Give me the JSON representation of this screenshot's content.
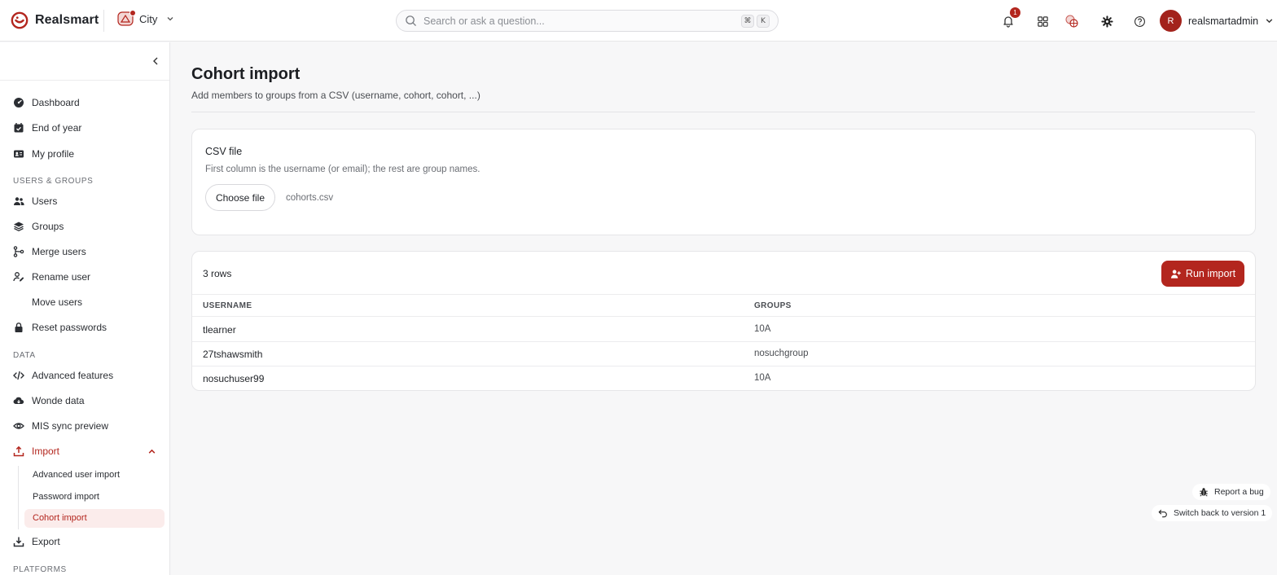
{
  "app": {
    "name": "Realsmart"
  },
  "school": {
    "name": "City"
  },
  "search": {
    "placeholder": "Search or ask a question...",
    "shortcut_keys": [
      "⌘",
      "K"
    ]
  },
  "header": {
    "notifications_count": "1",
    "user_initial": "R",
    "username": "realsmartadmin",
    "icons": [
      "bell-icon",
      "apps-grid-icon",
      "schools-globe-icon",
      "settings-gear-icon",
      "help-icon",
      "chevron-down-icon"
    ]
  },
  "sidebar": {
    "items": [
      {
        "label": "Dashboard",
        "icon": "dashboard-gauge-icon"
      },
      {
        "label": "End of year",
        "icon": "calendar-check-icon"
      },
      {
        "label": "My profile",
        "icon": "id-card-icon"
      }
    ],
    "section_users": "USERS & GROUPS",
    "user_items": [
      {
        "label": "Users",
        "icon": "users-icon"
      },
      {
        "label": "Groups",
        "icon": "layers-icon"
      },
      {
        "label": "Merge users",
        "icon": "merge-icon"
      },
      {
        "label": "Rename user",
        "icon": "user-pen-icon"
      },
      {
        "label": "Move users",
        "icon": ""
      },
      {
        "label": "Reset passwords",
        "icon": "lock-icon"
      }
    ],
    "section_data": "DATA",
    "data_items": [
      {
        "label": "Advanced features",
        "icon": "code-icon"
      },
      {
        "label": "Wonde data",
        "icon": "cloud-download-icon"
      },
      {
        "label": "MIS sync preview",
        "icon": "eye-icon"
      },
      {
        "label": "Import",
        "icon": "upload-icon"
      }
    ],
    "import_sub": [
      {
        "label": "Advanced user import"
      },
      {
        "label": "Password import"
      },
      {
        "label": "Cohort import"
      }
    ],
    "export": {
      "label": "Export",
      "icon": "download-icon"
    },
    "section_platforms": "PLATFORMS"
  },
  "page": {
    "title": "Cohort import",
    "subtitle": "Add members to groups from a CSV (username, cohort, cohort, ...)"
  },
  "upload": {
    "title": "CSV file",
    "help": "First column is the username (or email); the rest are group names.",
    "choose_label": "Choose file",
    "filename": "cohorts.csv"
  },
  "preview": {
    "rows_label": "3 rows",
    "run_label": "Run import",
    "columns": [
      "USERNAME",
      "GROUPS"
    ],
    "rows": [
      {
        "username": "tlearner",
        "groups": "10A"
      },
      {
        "username": "27tshawsmith",
        "groups": "nosuchgroup"
      },
      {
        "username": "nosuchuser99",
        "groups": "10A"
      }
    ]
  },
  "footer_actions": {
    "report_bug": "Report a bug",
    "switch_version": "Switch back to version 1"
  },
  "colors": {
    "accent": "#b3261e",
    "accent_soft": "#fbeceb",
    "background": "#f7f7f8"
  }
}
